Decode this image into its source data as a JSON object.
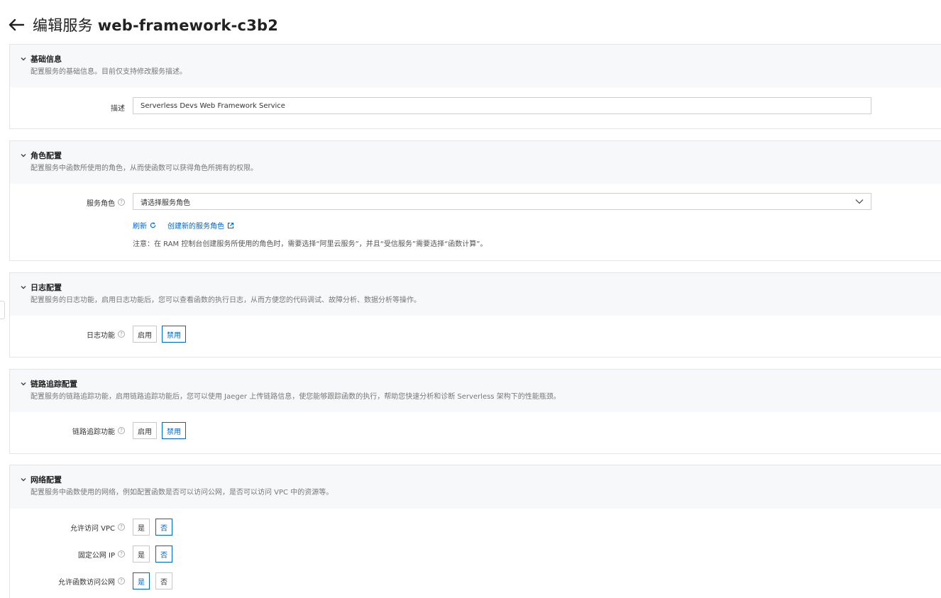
{
  "header": {
    "title_prefix": "编辑服务",
    "service_name": "web-framework-c3b2"
  },
  "sections": {
    "basic": {
      "title": "基础信息",
      "desc": "配置服务的基础信息。目前仅支持修改服务描述。",
      "desc_label": "描述",
      "desc_value": "Serverless Devs Web Framework Service"
    },
    "role": {
      "title": "角色配置",
      "desc": "配置服务中函数所使用的角色，从而使函数可以获得角色所拥有的权限。",
      "role_label": "服务角色",
      "role_placeholder": "请选择服务角色",
      "refresh": "刷新",
      "create_role": "创建新的服务角色",
      "note": "注意：在 RAM 控制台创建服务所使用的角色时，需要选择“阿里云服务”，并且“受信服务”需要选择“函数计算”。"
    },
    "log": {
      "title": "日志配置",
      "desc": "配置服务的日志功能，启用日志功能后，您可以查看函数的执行日志，从而方便您的代码调试、故障分析、数据分析等操作。",
      "label": "日志功能",
      "enable": "启用",
      "disable": "禁用"
    },
    "trace": {
      "title": "链路追踪配置",
      "desc": "配置服务的链路追踪功能，启用链路追踪功能后，您可以使用 Jaeger 上传链路信息，使您能够跟踪函数的执行，帮助您快速分析和诊断 Serverless 架构下的性能瓶颈。",
      "label": "链路追踪功能",
      "enable": "启用",
      "disable": "禁用"
    },
    "network": {
      "title": "网络配置",
      "desc": "配置服务中函数使用的网络，例如配置函数是否可以访问公网，是否可以访问 VPC 中的资源等。",
      "vpc_label": "允许访问 VPC",
      "fixed_ip_label": "固定公网 IP",
      "internet_label": "允许函数访问公网",
      "yes": "是",
      "no": "否"
    }
  },
  "colors": {
    "accent": "#0064c8",
    "section_head_bg": "#f7f8fa",
    "border": "#e5e5e5"
  }
}
